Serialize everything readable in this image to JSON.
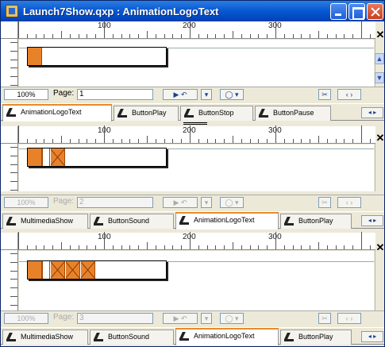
{
  "window": {
    "title": "Launch7Show.qxp : AnimationLogoText",
    "min_label": "",
    "max_label": "",
    "close_label": ""
  },
  "ruler": {
    "labels": [
      "100",
      "200",
      "300"
    ]
  },
  "panes": [
    {
      "zoom": "100%",
      "page_label": "Page:",
      "page": "1",
      "enabled": true
    },
    {
      "zoom": "100%",
      "page_label": "Page:",
      "page": "2",
      "enabled": false
    },
    {
      "zoom": "100%",
      "page_label": "Page:",
      "page": "3",
      "enabled": false
    }
  ],
  "tabsets": [
    {
      "tabs": [
        "AnimationLogoText",
        "ButtonPlay",
        "ButtonStop",
        "ButtonPause"
      ],
      "active": 0
    },
    {
      "tabs": [
        "MultimediaShow",
        "ButtonSound",
        "AnimationLogoText",
        "ButtonPlay"
      ],
      "active": 2
    },
    {
      "tabs": [
        "MultimediaShow",
        "ButtonSound",
        "AnimationLogoText",
        "ButtonPlay"
      ],
      "active": 2
    }
  ],
  "icons": {
    "close": "close-icon",
    "scroll_up": "chevron-up-icon",
    "scroll_down": "chevron-down-icon",
    "nav": "prev-next-icons"
  },
  "colors": {
    "titlebar": "#0a5ad4",
    "frame": "#e8822a",
    "active_tab": "#e68b2c"
  }
}
